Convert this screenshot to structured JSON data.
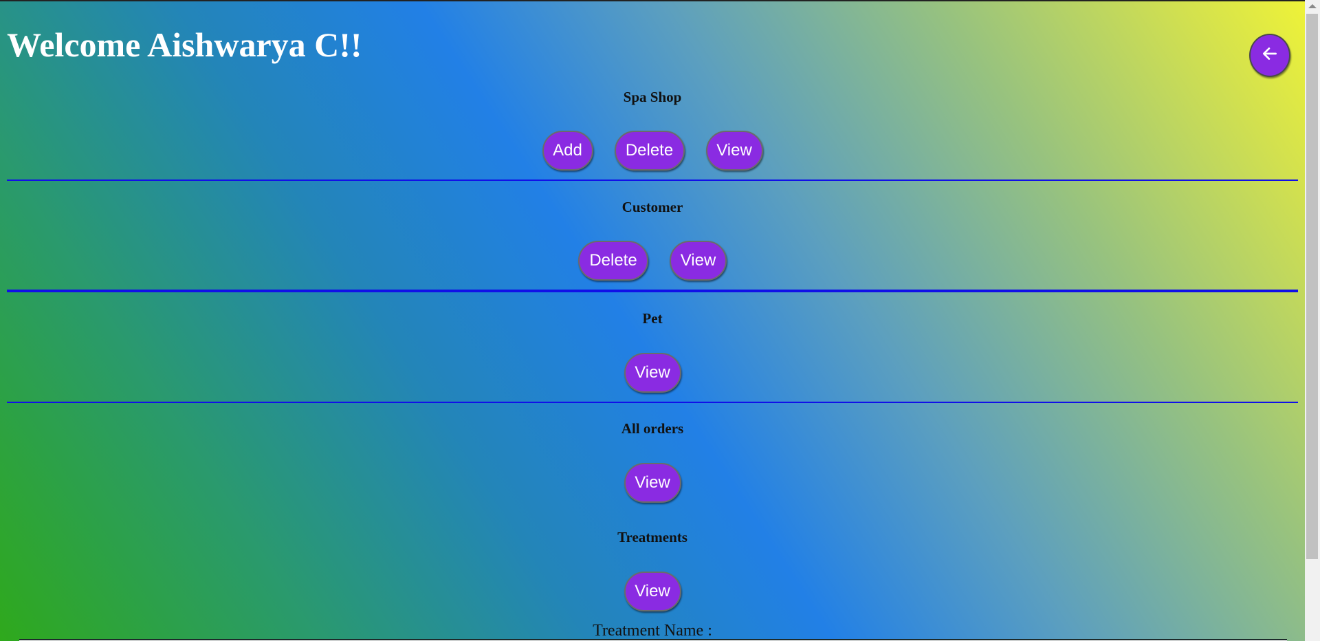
{
  "header": {
    "welcome": "Welcome Aishwarya C!!",
    "back_icon": "arrow-left-icon"
  },
  "sections": {
    "spa_shop": {
      "title": "Spa Shop",
      "add": "Add",
      "delete": "Delete",
      "view": "View"
    },
    "customer": {
      "title": "Customer",
      "delete": "Delete",
      "view": "View"
    },
    "pet": {
      "title": "Pet",
      "view": "View"
    },
    "all_orders": {
      "title": "All orders",
      "view": "View"
    },
    "treatments": {
      "title": "Treatments",
      "view": "View",
      "treatment_name_label": "Treatment Name :"
    }
  },
  "colors": {
    "button": "#8a2be2",
    "divider": "#1010e8",
    "gradient_start": "#2fa91c",
    "gradient_mid": "#2280e6",
    "gradient_end": "#f2f535"
  }
}
